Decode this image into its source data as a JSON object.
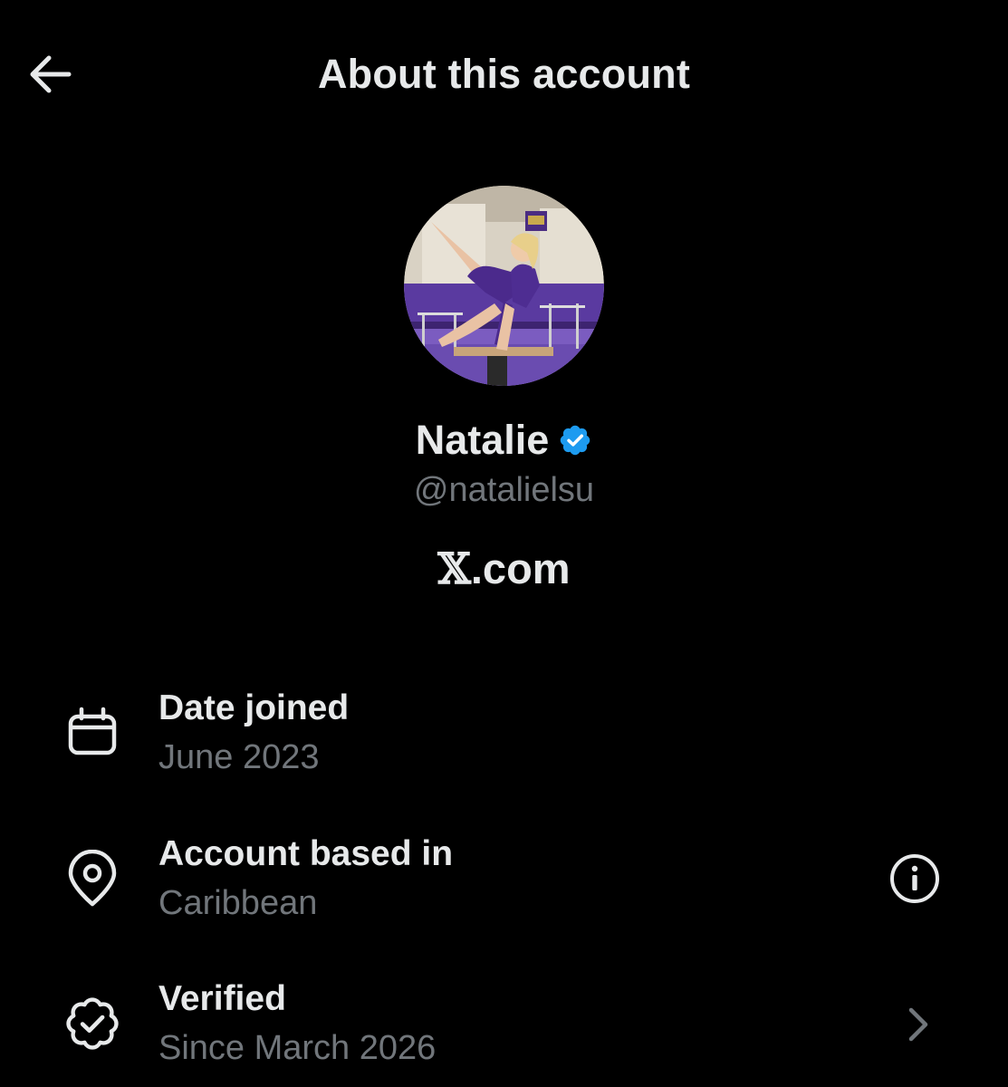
{
  "header": {
    "title": "About this account",
    "back_icon": "arrow-left-icon"
  },
  "profile": {
    "avatar_icon": "profile-photo",
    "display_name": "Natalie",
    "verified_badge_icon": "verified-badge-icon",
    "verified_badge_color": "#1d9bf0",
    "handle": "@natalielsu",
    "site_x": "𝕏",
    "site_rest": ".com"
  },
  "details": [
    {
      "icon": "calendar-icon",
      "label": "Date joined",
      "value": "June 2023"
    },
    {
      "icon": "location-pin-icon",
      "label": "Account based in",
      "value": "Caribbean",
      "action_icon": "info-icon"
    },
    {
      "icon": "verified-seal-icon",
      "label": "Verified",
      "value": "Since March 2026",
      "action_icon": "chevron-right-icon"
    }
  ],
  "colors": {
    "background": "#000000",
    "primary_text": "#e7e9ea",
    "secondary_text": "#71767b",
    "accent": "#1d9bf0"
  }
}
